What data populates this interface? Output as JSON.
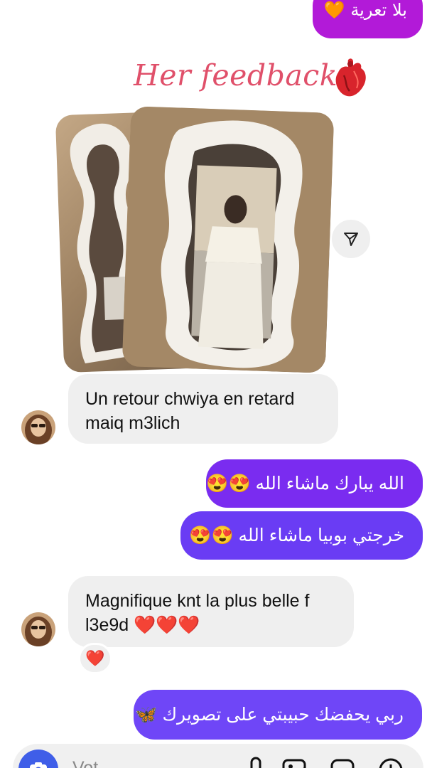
{
  "top_message": {
    "text": "بلا تعرية",
    "emoji": "🧡"
  },
  "header": {
    "title": "Her feedback"
  },
  "messages": {
    "m1": "Un retour chwiya en retard maiq m3lich",
    "m2": "الله يبارك ماشاء الله 😍😍",
    "m3": "خرجتي بوبيا ماشاء الله 😍😍",
    "m4": "Magnifique knt la plus belle f l3e9d ❤️❤️❤️",
    "m5": "ربي يحفضك حبيبتي على تصويرك 🦋"
  },
  "reaction": {
    "emoji": "❤️"
  },
  "composer": {
    "placeholder": "Vot"
  },
  "colors": {
    "outgoing": "#7a2cf0",
    "incoming": "#efefef",
    "title": "#e0506a",
    "camera": "#3f5ee8"
  }
}
